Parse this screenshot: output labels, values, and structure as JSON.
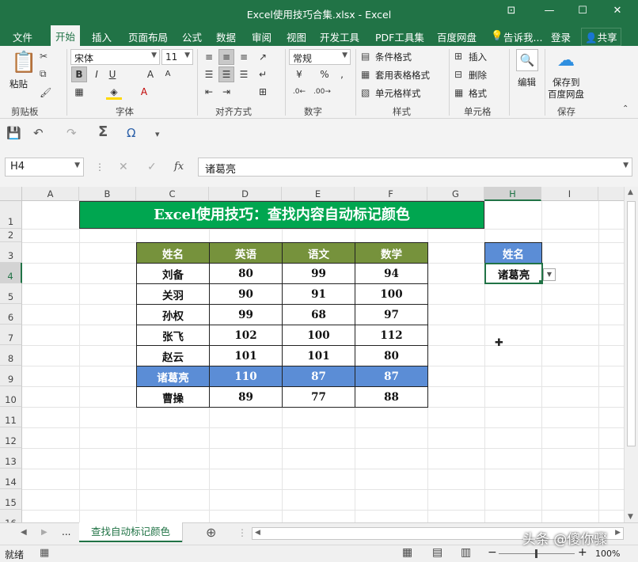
{
  "window": {
    "title": "Excel使用技巧合集.xlsx - Excel",
    "min": "—",
    "restore": "☐",
    "close": "✕",
    "ribbon_opt": "⊡"
  },
  "menu": {
    "tabs": [
      "文件",
      "开始",
      "插入",
      "页面布局",
      "公式",
      "数据",
      "审阅",
      "视图",
      "开发工具",
      "PDF工具集",
      "百度网盘"
    ],
    "tell_me": "告诉我...",
    "login": "登录",
    "share": "共享"
  },
  "ribbon": {
    "clipboard": {
      "paste": "粘贴",
      "label": "剪贴板"
    },
    "font": {
      "name": "宋体",
      "size": "11",
      "label": "字体",
      "bold": "B",
      "italic": "I",
      "underline": "U",
      "grow": "A",
      "shrink": "A"
    },
    "align": {
      "label": "对齐方式"
    },
    "number": {
      "format": "常规",
      "label": "数字",
      "percent": "%",
      "comma": ","
    },
    "styles": {
      "conditional": "条件格式",
      "table": "套用表格格式",
      "cell": "单元格样式",
      "label": "样式"
    },
    "cells": {
      "insert": "插入",
      "delete": "删除",
      "format": "格式",
      "label": "单元格"
    },
    "edit": {
      "label": "编辑"
    },
    "save": {
      "line1": "保存到",
      "line2": "百度网盘",
      "label": "保存"
    }
  },
  "formula_bar": {
    "name_box": "H4",
    "fx": "fx",
    "value": "诸葛亮"
  },
  "sheet": {
    "columns": [
      "A",
      "B",
      "C",
      "D",
      "E",
      "F",
      "G",
      "H",
      "I"
    ],
    "rows": [
      "1",
      "2",
      "3",
      "4",
      "5",
      "6",
      "7",
      "8",
      "9",
      "10",
      "11",
      "12",
      "13",
      "14",
      "15",
      "16"
    ],
    "banner": "Excel使用技巧：查找内容自动标记颜色",
    "table_headers": [
      "姓名",
      "英语",
      "语文",
      "数学"
    ],
    "table_rows": [
      [
        "刘备",
        "80",
        "99",
        "94"
      ],
      [
        "关羽",
        "90",
        "91",
        "100"
      ],
      [
        "孙权",
        "99",
        "68",
        "97"
      ],
      [
        "张飞",
        "102",
        "100",
        "112"
      ],
      [
        "赵云",
        "101",
        "101",
        "80"
      ],
      [
        "诸葛亮",
        "110",
        "87",
        "87"
      ],
      [
        "曹操",
        "89",
        "77",
        "88"
      ]
    ],
    "highlight_row": 5,
    "lookup_header": "姓名",
    "lookup_value": "诸葛亮"
  },
  "tabs": {
    "active_sheet": "查找自动标记颜色",
    "dots": "..."
  },
  "status": {
    "ready": "就绪",
    "zoom": "100%",
    "watermark": "头条 @傻你骤"
  },
  "colors": {
    "excel_green": "#217346",
    "banner_green": "#00a650",
    "header_olive": "#76923c",
    "highlight_blue": "#5b8dd6"
  }
}
